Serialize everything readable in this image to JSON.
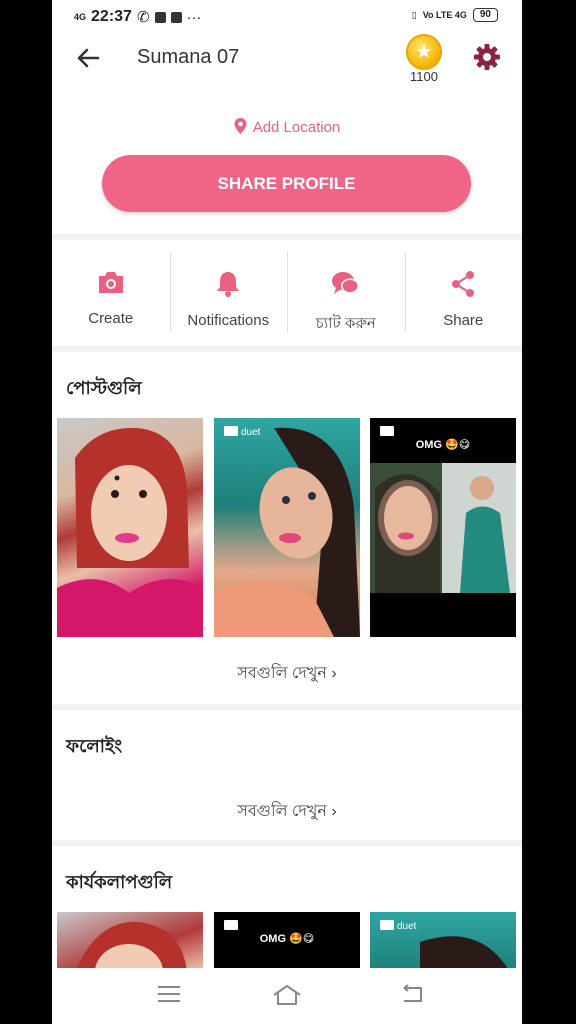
{
  "status_bar": {
    "network": "4G",
    "time": "22:37",
    "more": "···",
    "right_text": "Vo LTE 4G",
    "battery": "90"
  },
  "header": {
    "title": "Sumana 07",
    "coins": "1100"
  },
  "profile": {
    "location_label": "Add Location",
    "share_button": "SHARE PROFILE"
  },
  "actions": [
    {
      "label": "Create",
      "icon": "camera-icon"
    },
    {
      "label": "Notifications",
      "icon": "bell-icon"
    },
    {
      "label": "চ্যাট করুন",
      "icon": "chat-icon"
    },
    {
      "label": "Share",
      "icon": "share-icon"
    }
  ],
  "posts": {
    "title": "পোস্টগুলি",
    "see_all": "সবগুলি দেখুন  ›",
    "items": [
      {
        "badge": ""
      },
      {
        "badge": "duet"
      },
      {
        "badge": "OMG 🤩😋"
      }
    ]
  },
  "following": {
    "title": "ফলোইং",
    "see_all": "সবগুলি দেখুন  ›"
  },
  "activities": {
    "title": "কার্যকলাপগুলি",
    "items": [
      {
        "badge": ""
      },
      {
        "badge": "OMG 🤩😋"
      },
      {
        "badge": "duet"
      }
    ]
  },
  "colors": {
    "accent": "#f06488",
    "icon": "#e8627f",
    "background": "#f1f1f1"
  }
}
